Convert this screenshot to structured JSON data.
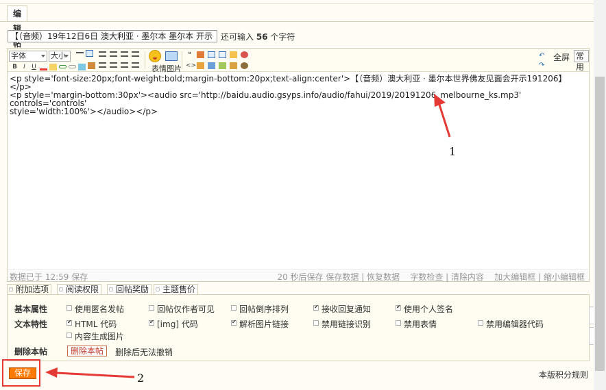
{
  "header": {
    "tab_label": "编辑帖子"
  },
  "title_field": {
    "value": "【（音频）19年12日6日 澳大利亚 · 墨尔本 墨尔本 开示",
    "remaining_prefix": "还可输入",
    "remaining_count": "56",
    "remaining_suffix": "个字符"
  },
  "toolbar": {
    "font_select": "字体",
    "size_select": "大小",
    "bold": "B",
    "italic": "I",
    "underline": "U",
    "emoticon_image_label": "表情图片",
    "fullscreen": "全屏",
    "common": "常用",
    "icons": [
      "bold-icon",
      "italic-icon",
      "underline-icon",
      "font-color-icon",
      "format-brush-icon",
      "link-icon",
      "unlink-icon",
      "eraser-icon",
      "align-left-icon",
      "align-center-icon",
      "align-right-icon",
      "justify-icon",
      "ordered-list-icon",
      "unordered-list-icon",
      "indent-icon",
      "outdent-icon",
      "emoticon-icon",
      "image-icon",
      "quote-icon",
      "code-icon",
      "table-icon",
      "flash-icon",
      "audio-icon",
      "video-icon",
      "hide-icon",
      "free-icon",
      "undo-icon",
      "redo-icon"
    ]
  },
  "editor": {
    "content": "<p style='font-size:20px;font-weight:bold;margin-bottom:20px;text-align:center'>【（音频）澳大利亚 · 墨尔本世界佛友见面会开示191206】</p>\n<p style='margin-bottom:30px'><audio src='http://baidu.audio.gsyps.info/audio/fahui/2019/20191206_melbourne_ks.mp3' controls='controls'\nstyle='width:100%'></audio></p>"
  },
  "status_bar": {
    "autosave": "数据已于 12:59 保存",
    "countdown": "20 秒后保存",
    "save_data": "保存数据",
    "restore_data": "恢复数据",
    "word_check": "字数检查",
    "clear_content": "清除内容",
    "enlarge": "加大编辑框",
    "shrink": "缩小编辑框"
  },
  "option_tabs": [
    "附加选项",
    "阅读权限",
    "回帖奖励",
    "主题售价"
  ],
  "options": {
    "basic_label": "基本属性",
    "text_label": "文本特性",
    "delete_label": "删除本帖",
    "basic": [
      {
        "label": "使用匿名发帖",
        "checked": false
      },
      {
        "label": "回帖仅作者可见",
        "checked": false
      },
      {
        "label": "回帖倒序排列",
        "checked": false
      },
      {
        "label": "接收回复通知",
        "checked": true
      },
      {
        "label": "使用个人签名",
        "checked": true
      }
    ],
    "text": [
      {
        "label": "HTML 代码",
        "checked": true
      },
      {
        "label": "[img] 代码",
        "checked": true
      },
      {
        "label": "解析图片链接",
        "checked": true
      },
      {
        "label": "禁用链接识别",
        "checked": false
      },
      {
        "label": "禁用表情",
        "checked": false
      },
      {
        "label": "禁用编辑器代码",
        "checked": false
      }
    ],
    "text_extra": {
      "label": "内容生成图片",
      "checked": false
    },
    "delete_button": "删除本帖",
    "delete_hint": "删除后无法撤销"
  },
  "footer": {
    "save_button": "保存",
    "rules_link": "本版积分规则"
  },
  "annotations": {
    "one": "1",
    "two": "2",
    "arrow_color": "#e53935"
  }
}
